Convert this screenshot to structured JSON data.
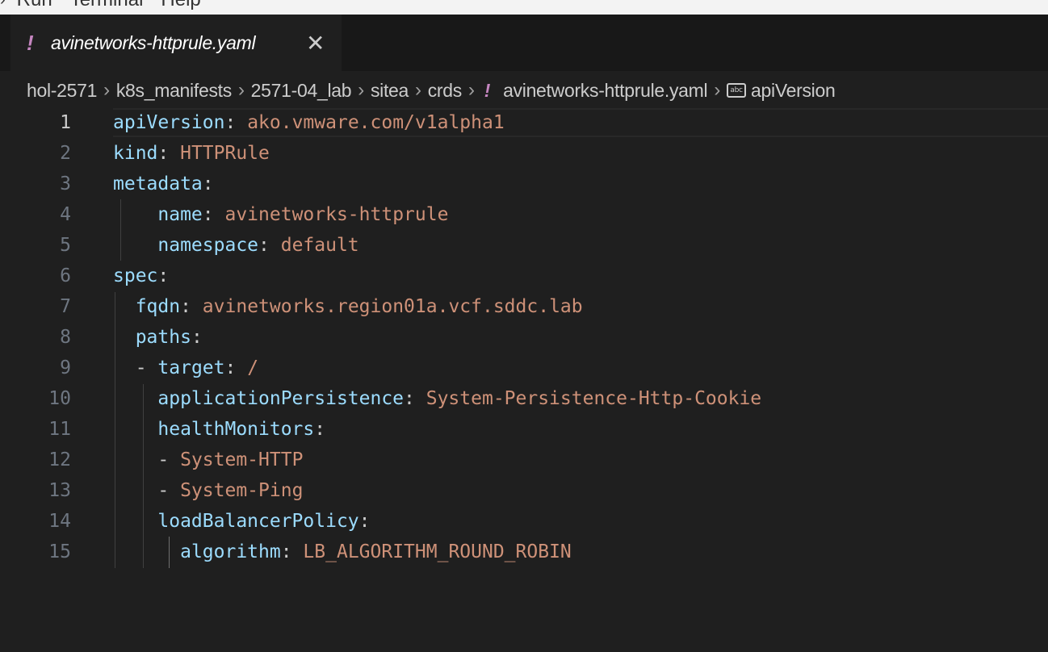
{
  "menubar": {
    "items": [
      "Run",
      "Terminal",
      "Help"
    ]
  },
  "tab": {
    "icon": "yaml-exclamation-icon",
    "mark": "!",
    "label": "avinetworks-httprule.yaml",
    "close": "✕"
  },
  "breadcrumb": {
    "segments": [
      "hol-2571",
      "k8s_manifests",
      "2571-04_lab",
      "sitea",
      "crds"
    ],
    "file_mark": "!",
    "file": "avinetworks-httprule.yaml",
    "symbol_icon": "abc",
    "symbol": "apiVersion",
    "separator": "›"
  },
  "editor": {
    "active_line": 1,
    "lines": [
      {
        "n": "1",
        "indent": "",
        "dash": "",
        "key": "apiVersion",
        "colon": ":",
        "value": " ako.vmware.com/v1alpha1"
      },
      {
        "n": "2",
        "indent": "",
        "dash": "",
        "key": "kind",
        "colon": ":",
        "value": " HTTPRule"
      },
      {
        "n": "3",
        "indent": "",
        "dash": "",
        "key": "metadata",
        "colon": ":",
        "value": ""
      },
      {
        "n": "4",
        "indent": "    ",
        "dash": "",
        "key": "name",
        "colon": ":",
        "value": " avinetworks-httprule"
      },
      {
        "n": "5",
        "indent": "    ",
        "dash": "",
        "key": "namespace",
        "colon": ":",
        "value": " default"
      },
      {
        "n": "6",
        "indent": "",
        "dash": "",
        "key": "spec",
        "colon": ":",
        "value": ""
      },
      {
        "n": "7",
        "indent": "  ",
        "dash": "",
        "key": "fqdn",
        "colon": ":",
        "value": " avinetworks.region01a.vcf.sddc.lab"
      },
      {
        "n": "8",
        "indent": "  ",
        "dash": "",
        "key": "paths",
        "colon": ":",
        "value": ""
      },
      {
        "n": "9",
        "indent": "  ",
        "dash": "- ",
        "key": "target",
        "colon": ":",
        "value": " /"
      },
      {
        "n": "10",
        "indent": "    ",
        "dash": "",
        "key": "applicationPersistence",
        "colon": ":",
        "value": " System-Persistence-Http-Cookie"
      },
      {
        "n": "11",
        "indent": "    ",
        "dash": "",
        "key": "healthMonitors",
        "colon": ":",
        "value": ""
      },
      {
        "n": "12",
        "indent": "    ",
        "dash": "- ",
        "key": "",
        "colon": "",
        "value": "System-HTTP"
      },
      {
        "n": "13",
        "indent": "    ",
        "dash": "- ",
        "key": "",
        "colon": "",
        "value": "System-Ping"
      },
      {
        "n": "14",
        "indent": "    ",
        "dash": "",
        "key": "loadBalancerPolicy",
        "colon": ":",
        "value": ""
      },
      {
        "n": "15",
        "indent": "      ",
        "dash": "",
        "key": "algorithm",
        "colon": ":",
        "value": " LB_ALGORITHM_ROUND_ROBIN"
      }
    ]
  }
}
